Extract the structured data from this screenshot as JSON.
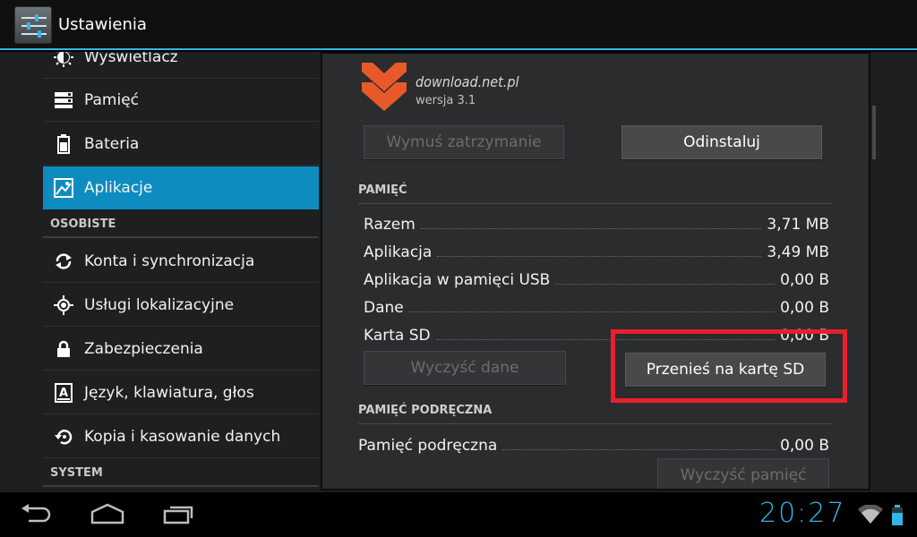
{
  "actionbar": {
    "title": "Ustawienia",
    "icon": "settings-sliders-icon"
  },
  "sidebar": {
    "items": [
      {
        "label": "Wyświetlacz",
        "icon": "brightness-icon",
        "active": false
      },
      {
        "label": "Pamięć",
        "icon": "storage-icon",
        "active": false
      },
      {
        "label": "Bateria",
        "icon": "battery-icon",
        "active": false
      },
      {
        "label": "Aplikacje",
        "icon": "apps-icon",
        "active": true
      }
    ],
    "header_personal": "OSOBISTE",
    "personal_items": [
      {
        "label": "Konta i synchronizacja",
        "icon": "sync-icon"
      },
      {
        "label": "Usługi lokalizacyjne",
        "icon": "location-icon"
      },
      {
        "label": "Zabezpieczenia",
        "icon": "lock-icon"
      },
      {
        "label": "Język, klawiatura, głos",
        "icon": "language-icon"
      },
      {
        "label": "Kopia i kasowanie danych",
        "icon": "backup-icon"
      }
    ],
    "header_system": "SYSTEM"
  },
  "detail": {
    "app_name": "download.net.pl",
    "app_version": "wersja 3.1",
    "force_stop_label": "Wymuś zatrzymanie",
    "uninstall_label": "Odinstaluj",
    "storage_header": "PAMIĘĆ",
    "storage_rows": [
      {
        "key": "Razem",
        "value": "3,71 MB"
      },
      {
        "key": "Aplikacja",
        "value": "3,49 MB"
      },
      {
        "key": "Aplikacja w pamięci USB",
        "value": "0,00 B"
      },
      {
        "key": "Dane",
        "value": "0,00 B"
      },
      {
        "key": "Karta SD",
        "value": "0,00 B"
      }
    ],
    "clear_data_label": "Wyczyść dane",
    "move_to_sd_label": "Przenieś na kartę SD",
    "cache_header": "PAMIĘĆ PODRĘCZNA",
    "cache_row": {
      "key": "Pamięć podręczna",
      "value": "0,00 B"
    },
    "clear_cache_label": "Wyczyść pamięć"
  },
  "statusbar": {
    "time": "20:27"
  },
  "colors": {
    "accent": "#33b5e5",
    "selected": "#0e8cc0",
    "highlight": "#e8202a",
    "logo": "#e8592a"
  }
}
